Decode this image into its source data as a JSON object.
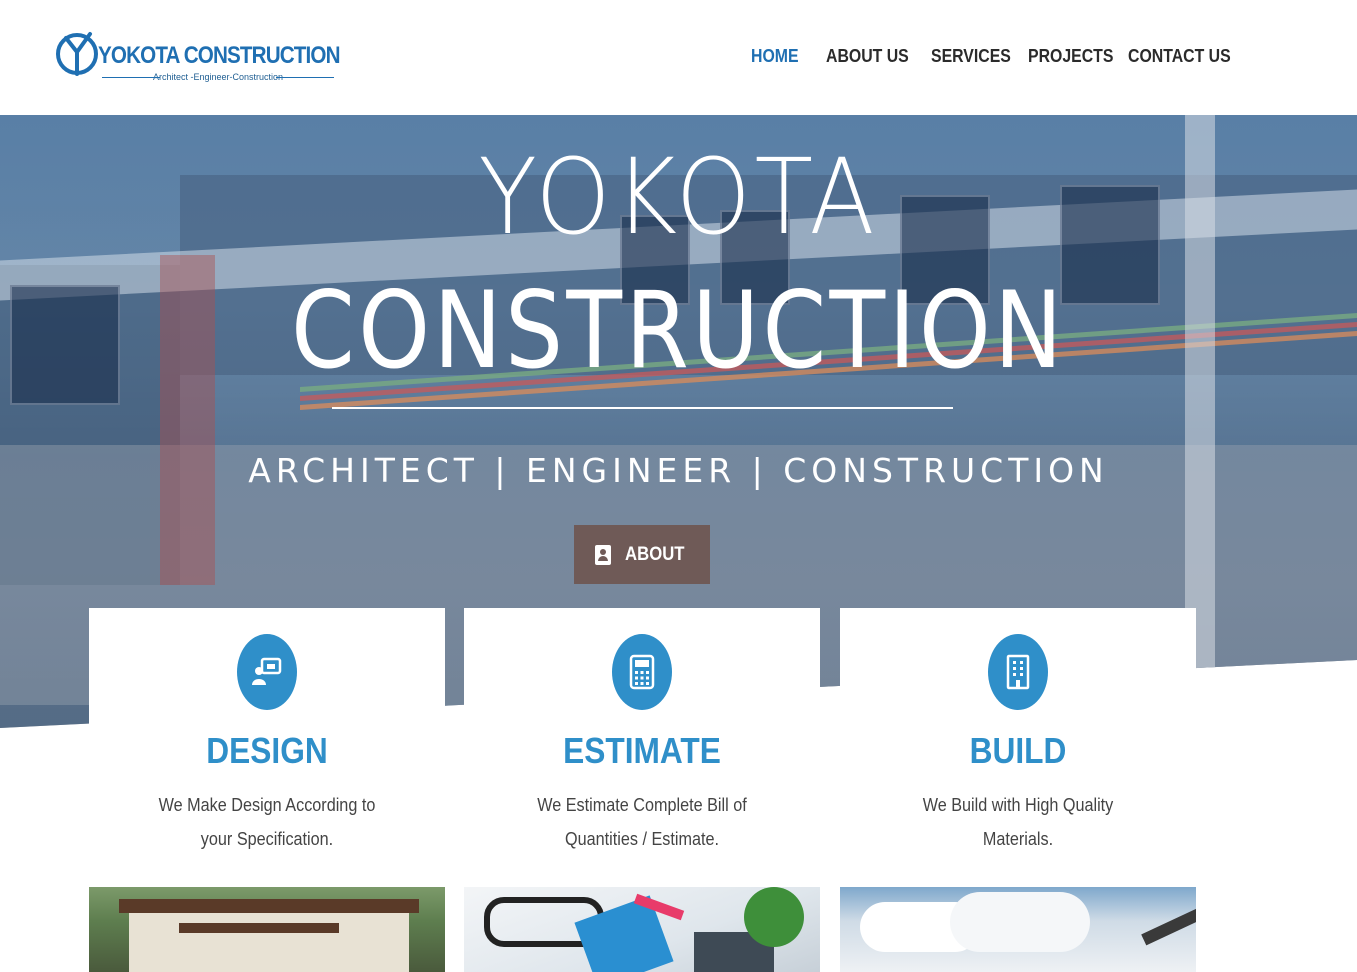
{
  "logo": {
    "name_part1": "YOKOTA",
    "name_part2": "CONSTRUCTION",
    "tagline": "Architect -Engineer-Construction"
  },
  "nav": [
    {
      "label": "HOME",
      "active": true
    },
    {
      "label": "ABOUT US",
      "active": false
    },
    {
      "label": "SERVICES",
      "active": false
    },
    {
      "label": "PROJECTS",
      "active": false
    },
    {
      "label": "CONTACT US",
      "active": false
    }
  ],
  "hero": {
    "title_line1": "YOKOTA",
    "title_line2": "CONSTRUCTION",
    "subtitle": "ARCHITECT | ENGINEER | CONSTRUCTION",
    "button_label": "ABOUT",
    "button_icon": "contact-card-icon"
  },
  "services": [
    {
      "title": "DESIGN",
      "description": "We Make Design According to your Specification.",
      "icon": "user-drawing-board-icon"
    },
    {
      "title": "ESTIMATE",
      "description": "We Estimate Complete Bill of Quantities / Estimate.",
      "icon": "calculator-icon"
    },
    {
      "title": "BUILD",
      "description": "We Build with High Quality Materials.",
      "icon": "building-icon"
    }
  ],
  "colors": {
    "accent": "#2f8fc9",
    "nav_active": "#1f6fb2",
    "nav_text": "#2b2b2b",
    "button_bg": "#6f5a57"
  }
}
